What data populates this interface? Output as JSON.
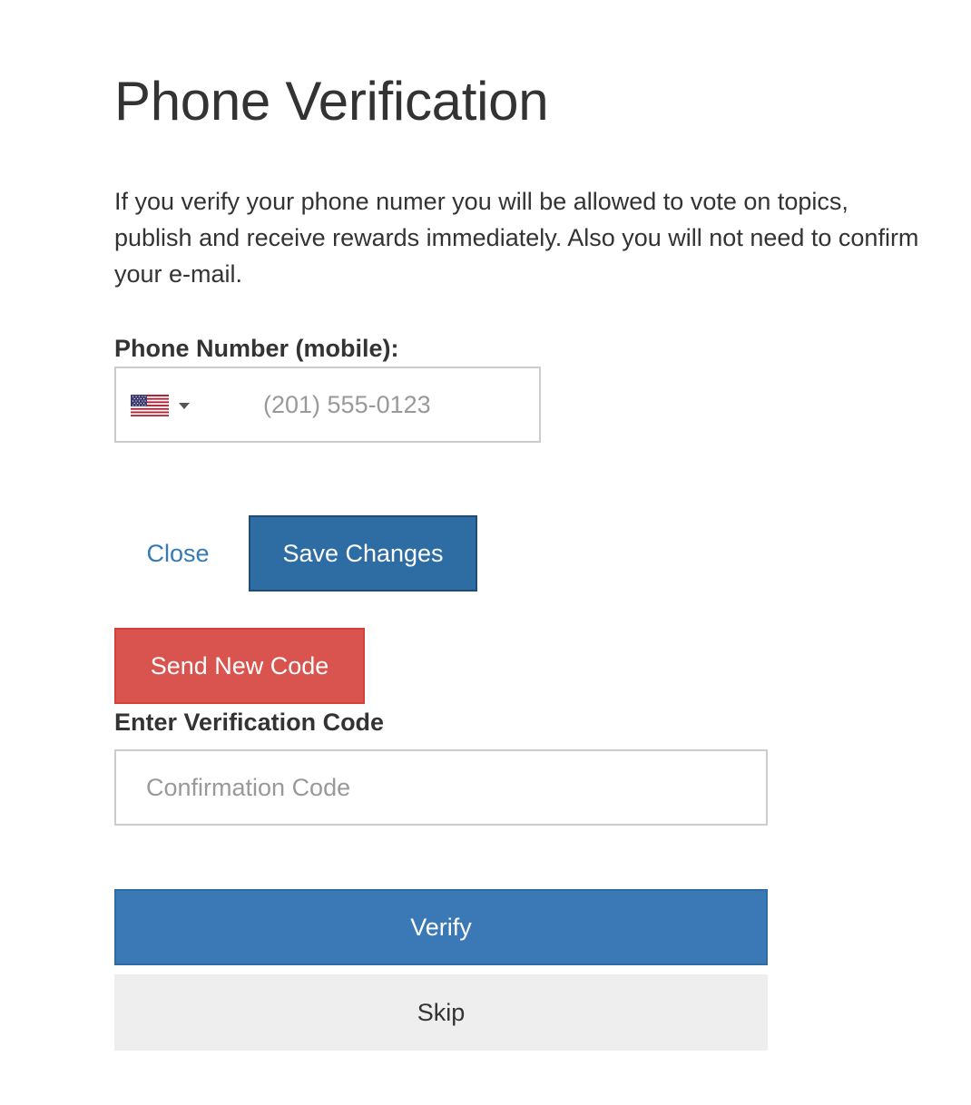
{
  "header": {
    "title": "Phone Verification"
  },
  "intro": {
    "text": "If you verify your phone numer you will be allowed to vote on topics, publish and receive rewards immediately. Also you will not need to confirm your e-mail."
  },
  "phone": {
    "label": "Phone Number (mobile):",
    "country_flag": "us-flag-icon",
    "value": "",
    "placeholder": "(201) 555-0123"
  },
  "actions": {
    "close_label": "Close",
    "save_label": "Save Changes",
    "send_code_label": "Send New Code"
  },
  "verification": {
    "label": "Enter Verification Code",
    "value": "",
    "placeholder": "Confirmation Code",
    "verify_label": "Verify",
    "skip_label": "Skip"
  },
  "colors": {
    "primary": "#3a79b6",
    "primary_dark": "#2e6da4",
    "danger": "#d9534f",
    "link": "#337ab7",
    "default_button": "#eeeeee",
    "text": "#333333"
  }
}
